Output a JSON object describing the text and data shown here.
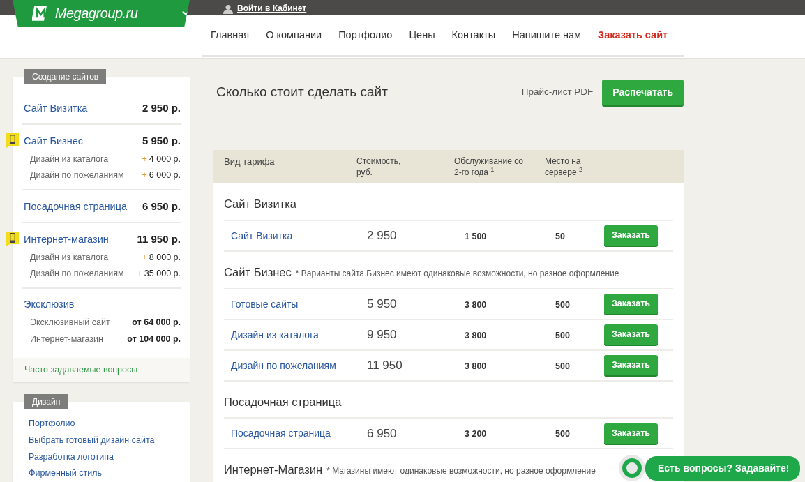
{
  "header": {
    "logo": "**Mega**group.ru",
    "login": "Войти в Кабинет"
  },
  "nav": [
    {
      "label": "Главная",
      "kind": "link"
    },
    {
      "label": "О компании",
      "kind": "link"
    },
    {
      "label": "Портфолио",
      "kind": "link"
    },
    {
      "label": "Цены",
      "kind": "link"
    },
    {
      "label": "Контакты",
      "kind": "link"
    },
    {
      "label": "Напишите нам",
      "kind": "link"
    },
    {
      "label": "Заказать сайт",
      "kind": "accent"
    }
  ],
  "sidebar": [
    {
      "title": "Создание сайтов",
      "items": [
        {
          "name": "Сайт Визитка",
          "price": "2 950 р.",
          "mobile": false
        },
        {
          "name": "Сайт Бизнес",
          "price": "5 950 р.",
          "mobile": true,
          "children": [
            {
              "name": "Дизайн из каталога",
              "prefix": "+",
              "price": "4 000 р.",
              "kind": "addon"
            },
            {
              "name": "Дизайн по пожеланиям",
              "prefix": "+",
              "price": "6 000 р.",
              "kind": "addon"
            }
          ]
        },
        {
          "name": "Посадочная страница",
          "price": "6 950 р.",
          "mobile": false
        },
        {
          "name": "Интернет-магазин",
          "price": "11 950 р.",
          "mobile": true,
          "children": [
            {
              "name": "Дизайн из каталога",
              "prefix": "+",
              "price": "8 000 р.",
              "kind": "addon"
            },
            {
              "name": "Дизайн по пожеланиям",
              "prefix": "+",
              "price": "35 000 р.",
              "kind": "addon"
            }
          ]
        },
        {
          "name": "Эксклюзив",
          "children": [
            {
              "name": "Эксклюзивный сайт",
              "price": "от 64 000 р.",
              "kind": "option"
            },
            {
              "name": "Интернет-магазин",
              "price": "от 104 000 р.",
              "kind": "option"
            }
          ]
        }
      ],
      "footer_link": "Часто задаваемые вопросы"
    },
    {
      "title": "Дизайн",
      "links": [
        "Портфолио",
        "Выбрать готовый дизайн сайта",
        "Разработка логотипа",
        "Фирменный стиль"
      ]
    }
  ],
  "main": {
    "title": "Сколько стоит сделать сайт",
    "pricelist": "Прайс-лист PDF",
    "print_button": "Распечатать",
    "columns": [
      "Вид тарифа",
      "Стоимость, руб.",
      "Обслуживание со 2-го года $^{1}$",
      "Место на сервере $^{2}$"
    ],
    "groups": [
      {
        "title": "Сайт Визитка",
        "rows": [
          {
            "name": "Сайт Визитка",
            "price": "2 950",
            "maintenance": "1 500",
            "space": "50",
            "button": "Заказать"
          }
        ]
      },
      {
        "title": "Сайт Бизнес",
        "note": "* Варианты сайта Бизнес имеют одинаковые возможности, но разное оформление",
        "rows": [
          {
            "name": "Готовые сайты",
            "price": "5 950",
            "maintenance": "3 800",
            "space": "500",
            "button": "Заказать"
          },
          {
            "name": "Дизайн из каталога",
            "price": "9 950",
            "maintenance": "3 800",
            "space": "500",
            "button": "Заказать"
          },
          {
            "name": "Дизайн по пожеланиям",
            "price": "11 950",
            "maintenance": "3 800",
            "space": "500",
            "button": "Заказать"
          }
        ]
      },
      {
        "title": "Посадочная страница",
        "rows": [
          {
            "name": "Посадочная страница",
            "price": "6 950",
            "maintenance": "3 200",
            "space": "500",
            "button": "Заказать"
          }
        ]
      },
      {
        "title": "Интернет-Магазин",
        "note": "* Магазины имеют одинаковые возможности, но разное оформление"
      }
    ]
  },
  "chat": {
    "label": "Есть вопросы? Задавайте!"
  }
}
